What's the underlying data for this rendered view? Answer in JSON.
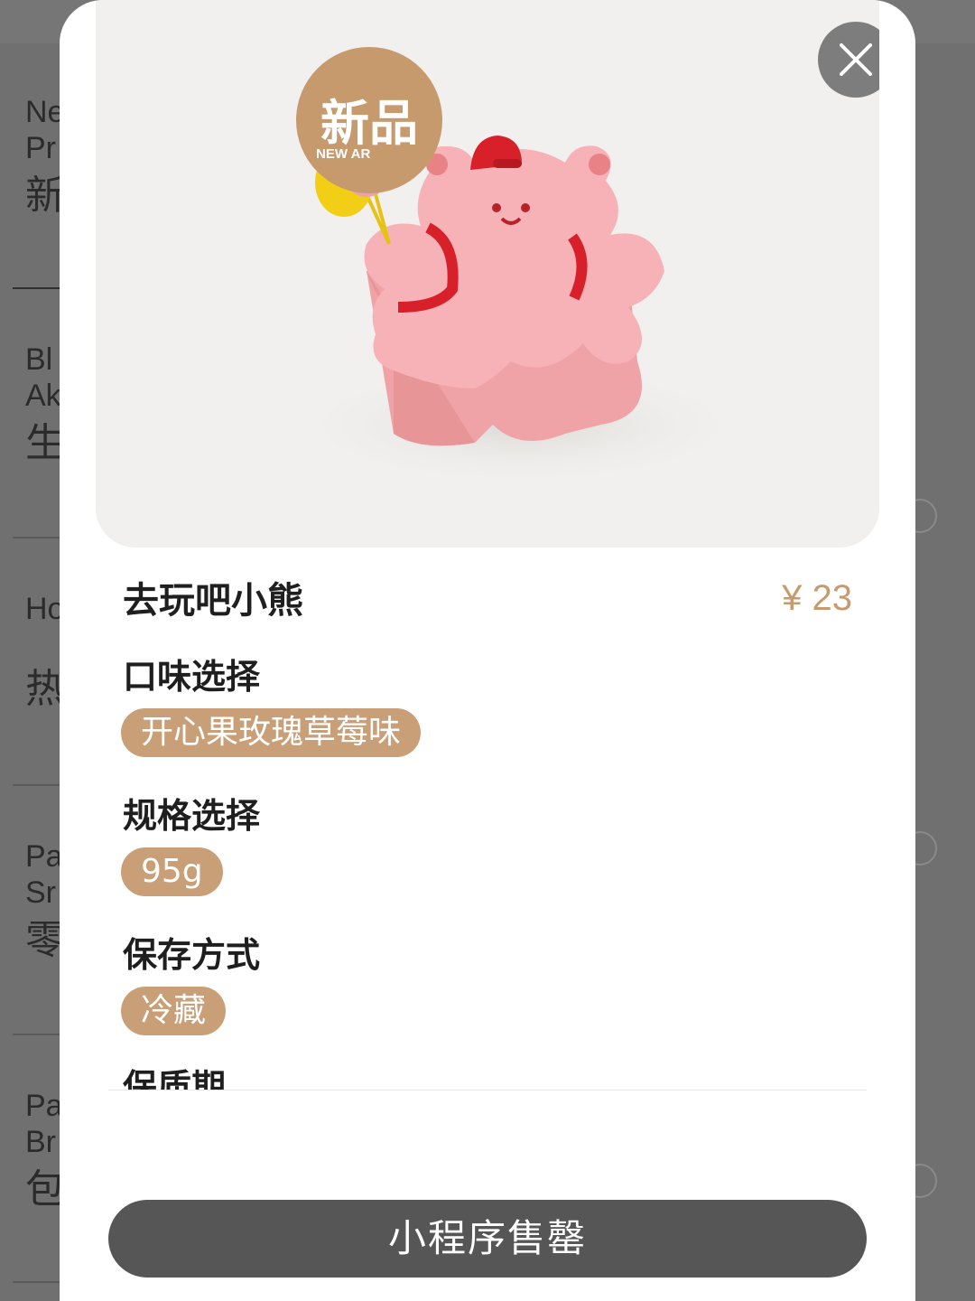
{
  "background": {
    "items": [
      {
        "en": "Ne",
        "en2": "Pr",
        "cn": "新"
      },
      {
        "en": "Bl",
        "en2": "Ak",
        "cn": "生"
      },
      {
        "en": "Ho",
        "en2": "",
        "cn": "热"
      },
      {
        "en": "Pa",
        "en2": "Sr",
        "cn": "零"
      },
      {
        "en": "Pa",
        "en2": "Br",
        "cn": "包"
      }
    ]
  },
  "product": {
    "badge_cn": "新品",
    "badge_en": "NEW AR",
    "name": "去玩吧小熊",
    "price": "¥ 23",
    "flavor_label": "口味选择",
    "flavor_value": "开心果玫瑰草莓味",
    "spec_label": "规格选择",
    "spec_value": "95g",
    "storage_label": "保存方式",
    "storage_value": "冷藏",
    "shelf_label": "保质期"
  },
  "actions": {
    "buy_label": "小程序售罄"
  },
  "colors": {
    "accent": "#c79a6e",
    "button": "#565656"
  },
  "icons": {
    "close": "close-icon"
  }
}
